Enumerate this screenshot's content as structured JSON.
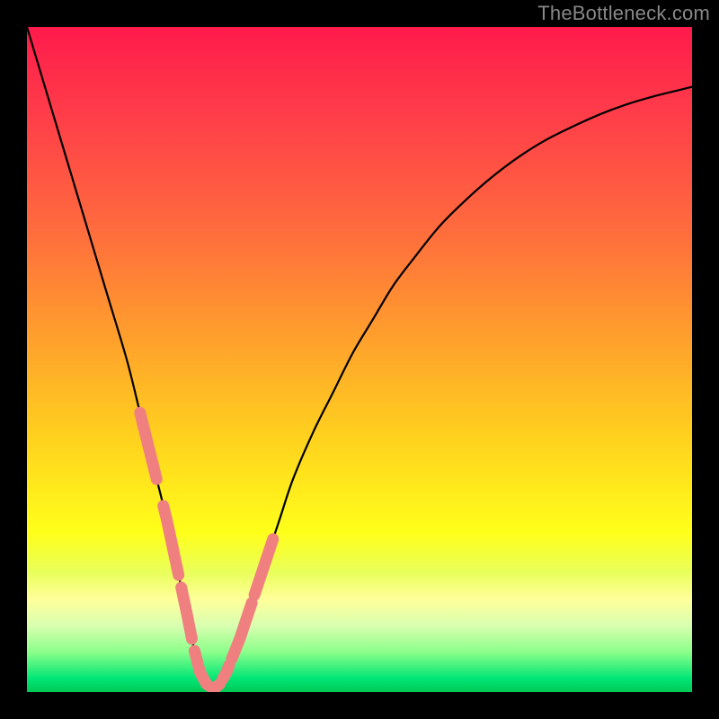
{
  "watermark": "TheBottleneck.com",
  "chart_data": {
    "type": "line",
    "title": "",
    "xlabel": "",
    "ylabel": "",
    "xlim": [
      0,
      100
    ],
    "ylim": [
      0,
      100
    ],
    "x": [
      0,
      3,
      6,
      9,
      12,
      15,
      17,
      19,
      21,
      22.5,
      24,
      25,
      26,
      27,
      28,
      29,
      30,
      32,
      34,
      36,
      38,
      40,
      43,
      46,
      49,
      52,
      55,
      58,
      62,
      66,
      70,
      74,
      78,
      82,
      86,
      90,
      94,
      98,
      100
    ],
    "y": [
      100,
      90,
      80,
      70,
      60,
      50,
      42,
      34,
      26,
      19,
      12,
      7,
      3,
      1.2,
      0.4,
      1.2,
      3,
      8,
      14,
      20,
      26,
      32,
      39,
      45,
      51,
      56,
      61,
      65,
      70,
      74,
      77.5,
      80.5,
      83,
      85,
      86.8,
      88.3,
      89.5,
      90.5,
      91
    ],
    "gradient_stops": [
      {
        "pos": 0.0,
        "color": "#ff1a4b"
      },
      {
        "pos": 0.12,
        "color": "#ff3a4a"
      },
      {
        "pos": 0.3,
        "color": "#ff6a3e"
      },
      {
        "pos": 0.45,
        "color": "#ff9a2e"
      },
      {
        "pos": 0.62,
        "color": "#ffd21e"
      },
      {
        "pos": 0.76,
        "color": "#ffff1a"
      },
      {
        "pos": 0.82,
        "color": "#e9ff5a"
      },
      {
        "pos": 0.86,
        "color": "#ffff9a"
      },
      {
        "pos": 0.9,
        "color": "#d9ffb0"
      },
      {
        "pos": 0.94,
        "color": "#8bff8b"
      },
      {
        "pos": 0.98,
        "color": "#00e676"
      },
      {
        "pos": 1.0,
        "color": "#00c853"
      }
    ],
    "marker_color": "#f08080",
    "curve_color": "#000000",
    "marker_segments_x_ranges": [
      [
        17,
        19.5
      ],
      [
        20.5,
        22.8
      ],
      [
        23.2,
        24.8
      ],
      [
        25.2,
        27.2
      ],
      [
        27.8,
        29.0
      ],
      [
        29.4,
        30.4
      ],
      [
        30.8,
        33.8
      ],
      [
        34.2,
        37.0
      ]
    ]
  }
}
